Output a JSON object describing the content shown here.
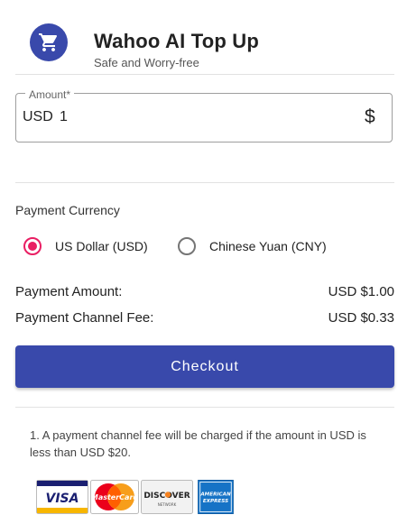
{
  "header": {
    "title": "Wahoo AI Top Up",
    "subtitle": "Safe and Worry-free",
    "logo_icon": "shopping-cart-icon",
    "logo_color": "#3949ab"
  },
  "amount": {
    "label": "Amount",
    "required_mark": "*",
    "currency_prefix": "USD",
    "value": "1",
    "suffix_icon": "dollar-icon",
    "suffix_symbol": "$"
  },
  "payment_currency": {
    "label": "Payment Currency",
    "options": [
      {
        "label": "US Dollar (USD)",
        "selected": true
      },
      {
        "label": "Chinese Yuan (CNY)",
        "selected": false
      }
    ],
    "selected_color": "#e91e63"
  },
  "summary": {
    "amount_label": "Payment Amount:",
    "amount_value": "USD $1.00",
    "fee_label": "Payment Channel Fee:",
    "fee_value": "USD $0.33"
  },
  "checkout": {
    "label": "Checkout",
    "color": "#3949ab"
  },
  "notes": [
    "1. A payment channel fee will be charged if the amount in USD is less than USD $20."
  ],
  "payment_methods": [
    {
      "name": "visa-card-icon",
      "text": "VISA"
    },
    {
      "name": "mastercard-icon",
      "text": "MasterCard"
    },
    {
      "name": "discover-card-icon",
      "text": "DISCOVER",
      "subtext": "NETWORK"
    },
    {
      "name": "amex-card-icon",
      "text": "AMERICAN",
      "subtext": "EXPRESS"
    }
  ]
}
